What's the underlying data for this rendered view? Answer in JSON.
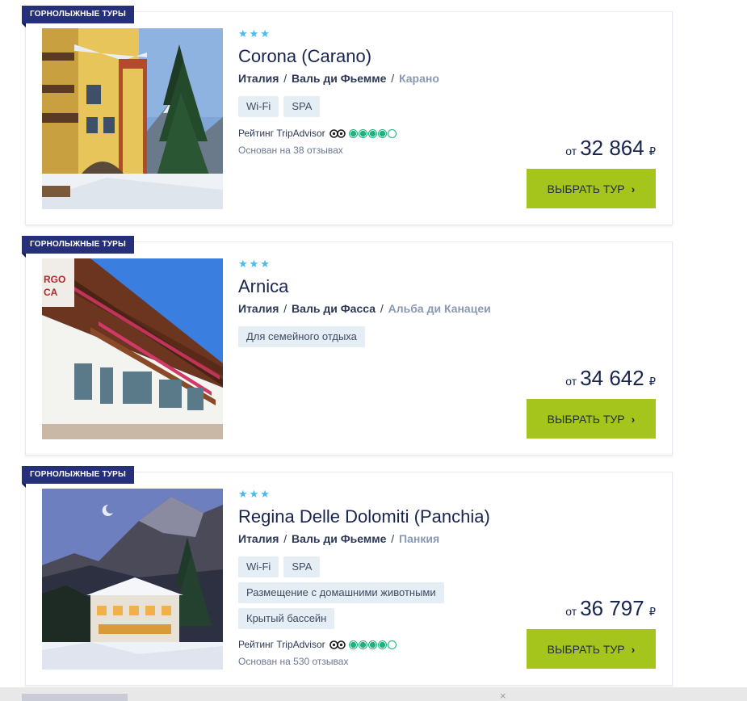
{
  "hotels": [
    {
      "badge": "ГОРНОЛЫЖНЫЕ ТУРЫ",
      "stars": "★★★",
      "name": "Corona (Carano)",
      "country": "Италия",
      "region": "Валь ди Фьемме",
      "city": "Карано",
      "tags": [
        "Wi-Fi",
        "SPA"
      ],
      "rating_label": "Рейтинг",
      "rating_source": "TripAdvisor",
      "rating_value": 4,
      "reviews": "Основан на 38 отзывах",
      "price_from": "от",
      "price": "32 864",
      "currency": "₽",
      "button_label": "ВЫБРАТЬ ТУР",
      "photo": "hotel-facade-winter"
    },
    {
      "badge": "ГОРНОЛЫЖНЫЕ ТУРЫ",
      "stars": "★★★",
      "name": "Arnica",
      "country": "Италия",
      "region": "Валь ди Фасса",
      "city": "Альба ди Канацеи",
      "tags": [
        "Для семейного отдыха"
      ],
      "price_from": "от",
      "price": "34 642",
      "currency": "₽",
      "button_label": "ВЫБРАТЬ ТУР",
      "photo": "hotel-balconies-flowers"
    },
    {
      "badge": "ГОРНОЛЫЖНЫЕ ТУРЫ",
      "stars": "★★★",
      "name": "Regina Delle Dolomiti (Panchia)",
      "country": "Италия",
      "region": "Валь ди Фьемме",
      "city": "Панкия",
      "tags": [
        "Wi-Fi",
        "SPA",
        "Размещение с домашними животными",
        "Крытый бассейн"
      ],
      "rating_label": "Рейтинг",
      "rating_source": "TripAdvisor",
      "rating_value": 4,
      "reviews": "Основан на 530 отзывах",
      "price_from": "от",
      "price": "36 797",
      "currency": "₽",
      "button_label": "ВЫБРАТЬ ТУР",
      "photo": "hotel-mountain-night"
    }
  ],
  "colors": {
    "badge": "#26307a",
    "stars": "#4bb8ee",
    "button": "#a6c51c",
    "tag_bg": "#e6eef5",
    "tripadvisor": "#22b07d"
  },
  "bottom_bar": {
    "close_icon": "×"
  }
}
